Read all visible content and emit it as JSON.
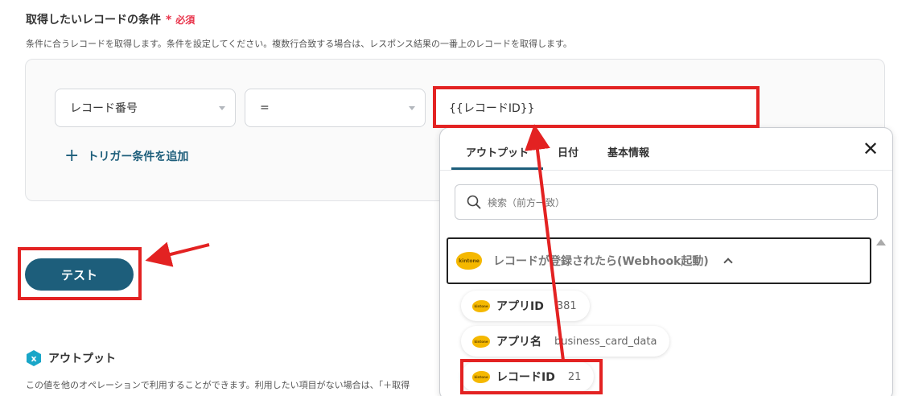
{
  "section": {
    "title": "取得したいレコードの条件",
    "required_star": "*",
    "required_label": "必須",
    "description": "条件に合うレコードを取得します。条件を設定してください。複数行合致する場合は、レスポンス結果の一番上のレコードを取得します。"
  },
  "condition": {
    "field_value": "レコード番号",
    "operator_value": "=",
    "value": "{{レコードID}}",
    "add_label": "トリガー条件を追加"
  },
  "test_button": "テスト",
  "output": {
    "icon_text": "x",
    "title": "アウトプット",
    "description": "この値を他のオペレーションで利用することができます。利用したい項目がない場合は、「＋取得"
  },
  "panel": {
    "tabs": [
      "アウトプット",
      "日付",
      "基本情報"
    ],
    "search_placeholder": "検索（前方一致）",
    "group_title": "レコードが登録されたら(Webhook起動)",
    "kintone_logo": "kintone",
    "items": [
      {
        "label": "アプリID",
        "value": "381"
      },
      {
        "label": "アプリ名",
        "value": "business_card_data"
      },
      {
        "label": "レコードID",
        "value": "21"
      }
    ]
  },
  "colors": {
    "accent": "#1d5e7b",
    "required": "#e8334a",
    "annotation": "#e32222",
    "kintone": "#f5b800"
  }
}
